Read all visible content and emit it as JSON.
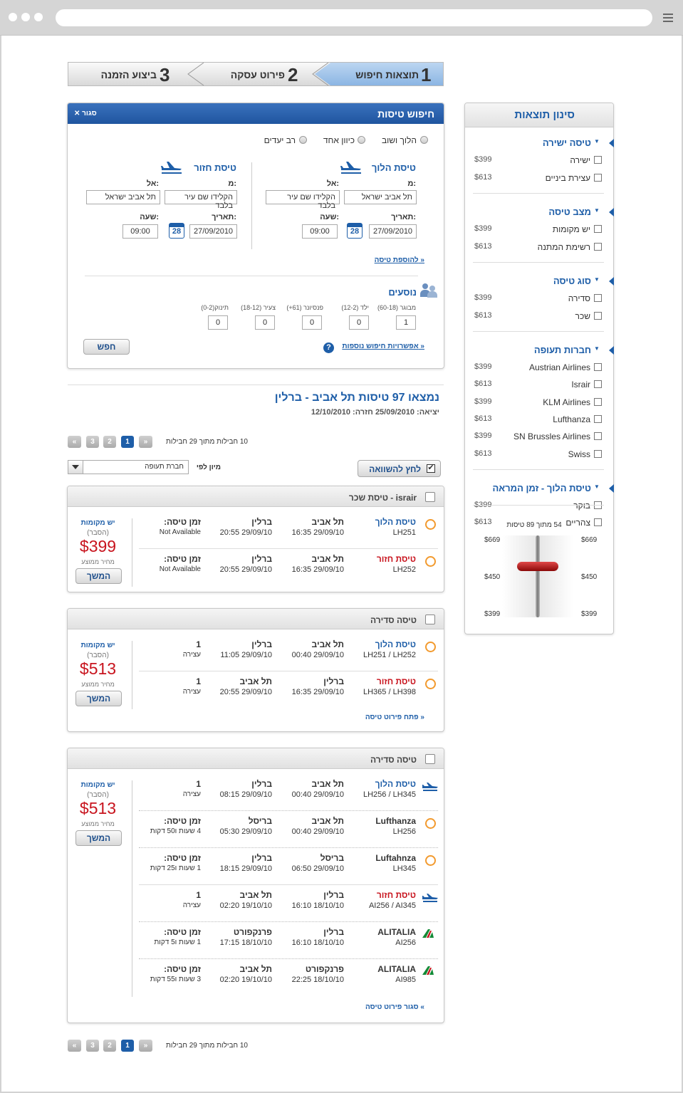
{
  "steps": [
    {
      "num": "1",
      "label": "תוצאות חיפוש"
    },
    {
      "num": "2",
      "label": "פירוט עסקה"
    },
    {
      "num": "3",
      "label": "ביצוע הזמנה"
    }
  ],
  "search": {
    "title": "חיפוש טיסות",
    "close": "סגור",
    "trip_types": [
      "הלוך ושוב",
      "כיוון אחד",
      "רב יעדים"
    ],
    "outbound": {
      "title": "טיסת הלוך",
      "from_label": "מ:",
      "to_label": "אל:",
      "from": "תל אביב ישראל",
      "to": "הקלידו שם עיר בלבד",
      "date_label": "תאריך:",
      "time_label": "שעה:",
      "date": "27/09/2010",
      "time": "09:00"
    },
    "return": {
      "title": "טיסת חזור",
      "from_label": "מ:",
      "to_label": "אל:",
      "from": "הקלידו שם עיר בלבד",
      "to": "תל אביב ישראל",
      "date_label": "תאריך:",
      "time_label": "שעה:",
      "date": "27/09/2010",
      "time": "09:00"
    },
    "add_flight": "להוספת טיסה",
    "cal_num": "28",
    "passengers_title": "נוסעים",
    "passengers": [
      {
        "label": "מבוגר (60-18)",
        "value": "1"
      },
      {
        "label": "ילד (12-2)",
        "value": "0"
      },
      {
        "label": "פנסיונר (61+)",
        "value": "0"
      },
      {
        "label": "צעיר (18-12)",
        "value": "0"
      },
      {
        "label": "תינוק(0-2)",
        "value": "0"
      }
    ],
    "more_options": "אפשרויות חיפוש נוספות",
    "search_btn": "חפש"
  },
  "results": {
    "title": "נמצאו 97 טיסות תל אביב - ברלין",
    "subtitle": "יציאה: 25/09/2010 חזרה: 12/10/2010",
    "pages_text": "10 חבילות מתוך 29 חבילות",
    "pages": [
      "1",
      "2",
      "3"
    ],
    "compare_btn": "לחץ להשוואה",
    "sort_label": "מיון לפי",
    "sort_value": "חברת תעופה"
  },
  "cards": [
    {
      "header": "israir - טיסת שכר",
      "avail": "יש מקומות",
      "explain": "(הסבר)",
      "price": "$399",
      "avg": "מחיר ממוצע",
      "cont": "המשך",
      "rows": [
        {
          "kind": "טיסת הלוך",
          "code": "LH251",
          "from": "תל אביב",
          "dep": "16:35 29/09/10",
          "to": "ברלין",
          "arr": "20:55 29/09/10",
          "dur_l": "זמן טיסה:",
          "dur": "Not Available"
        },
        {
          "kind": "טיסת חזור",
          "code": "LH252",
          "from": "תל אביב",
          "dep": "16:35 29/09/10",
          "to": "ברלין",
          "arr": "20:55 29/09/10",
          "dur_l": "זמן טיסה:",
          "dur": "Not Available"
        }
      ]
    },
    {
      "header": "טיסה סדירה",
      "avail": "יש מקומות",
      "explain": "(הסבר)",
      "price": "$513",
      "avg": "מחיר ממוצע",
      "cont": "המשך",
      "link": "פתח פירוט טיסה",
      "rows": [
        {
          "kind": "טיסת הלוך",
          "code": "LH251 / LH252",
          "from": "תל אביב",
          "dep": "00:40 29/09/10",
          "to": "ברלין",
          "arr": "11:05 29/09/10",
          "dur_l": "1",
          "dur": "עצירה"
        },
        {
          "kind": "טיסת חזור",
          "code": "LH365 / LH398",
          "from": "ברלין",
          "dep": "16:35 29/09/10",
          "to": "תל אביב",
          "arr": "20:55 29/09/10",
          "dur_l": "1",
          "dur": "עצירה"
        }
      ]
    },
    {
      "header": "טיסה סדירה",
      "avail": "יש מקומות",
      "explain": "(הסבר)",
      "price": "$513",
      "avg": "מחיר ממוצע",
      "cont": "המשך",
      "link": "סגור פירוט טיסה",
      "rows": [
        {
          "kind": "טיסת הלוך",
          "code": "LH256 / LH345",
          "from": "תל אביב",
          "dep": "00:40 29/09/10",
          "to": "ברלין",
          "arr": "08:15 29/09/10",
          "dur_l": "1",
          "dur": "עצירה"
        },
        {
          "kind": "Lufthanza",
          "code": "LH256",
          "from": "תל אביב",
          "dep": "00:40 29/09/10",
          "to": "בריסל",
          "arr": "05:30 29/09/10",
          "dur_l": "זמן טיסה:",
          "dur": "4 שעות ו50 דקות"
        },
        {
          "kind": "Luftahnza",
          "code": "LH345",
          "from": "בריסל",
          "dep": "06:50 29/09/10",
          "to": "ברלין",
          "arr": "18:15 29/09/10",
          "dur_l": "זמן טיסה:",
          "dur": "1 שעות ו25 דקות"
        },
        {
          "kind": "טיסת חזור",
          "code": "AI256 / AI345",
          "from": "ברלין",
          "dep": "16:10 18/10/10",
          "to": "תל אביב",
          "arr": "02:20 19/10/10",
          "dur_l": "1",
          "dur": "עצירה"
        },
        {
          "kind": "ALITALIA",
          "code": "AI256",
          "from": "ברלין",
          "dep": "16:10 18/10/10",
          "to": "פרנקפורט",
          "arr": "17:15 18/10/10",
          "dur_l": "זמן טיסה:",
          "dur": "1 שעות ו5 דקות"
        },
        {
          "kind": "ALITALIA",
          "code": "AI985",
          "from": "פרנקפורט",
          "dep": "22:25 18/10/10",
          "to": "תל אביב",
          "arr": "02:20 19/10/10",
          "dur_l": "זמן טיסה:",
          "dur": "3 שעות ו55 דקות"
        }
      ]
    }
  ],
  "filter": {
    "title": "סינון תוצאות",
    "groups": [
      {
        "title": "טיסה ישירה",
        "items": [
          {
            "label": "ישירה",
            "price": "$399"
          },
          {
            "label": "עצירת ביניים",
            "price": "$613"
          }
        ]
      },
      {
        "title": "מצב טיסה",
        "items": [
          {
            "label": "יש מקומות",
            "price": "$399"
          },
          {
            "label": "רשימת המתנה",
            "price": "$613"
          }
        ]
      },
      {
        "title": "סוג טיסה",
        "items": [
          {
            "label": "סדירה",
            "price": "$399"
          },
          {
            "label": "שכר",
            "price": "$613"
          }
        ]
      },
      {
        "title": "חברות תעופה",
        "items": [
          {
            "label": "Austrian Airlines",
            "price": "$399"
          },
          {
            "label": "Israir",
            "price": "$613"
          },
          {
            "label": "KLM Airlines",
            "price": "$399"
          },
          {
            "label": "Lufthanza",
            "price": "$613"
          },
          {
            "label": "SN Brussles Airlines",
            "price": "$399"
          },
          {
            "label": "Swiss",
            "price": "$613"
          }
        ]
      },
      {
        "title": "טיסת הלוך - זמן המראה",
        "items": [
          {
            "label": "בוקר",
            "price": "$399"
          },
          {
            "label": "צהריים",
            "price": "$613"
          }
        ]
      }
    ],
    "slider_caption": "54 מתוך 89 טיסות",
    "slider_values": [
      "$669",
      "$450",
      "$399"
    ]
  },
  "colors": {
    "accent": "#1e5ea8",
    "price": "#c8141e",
    "header_bar": "#2a62ad"
  }
}
